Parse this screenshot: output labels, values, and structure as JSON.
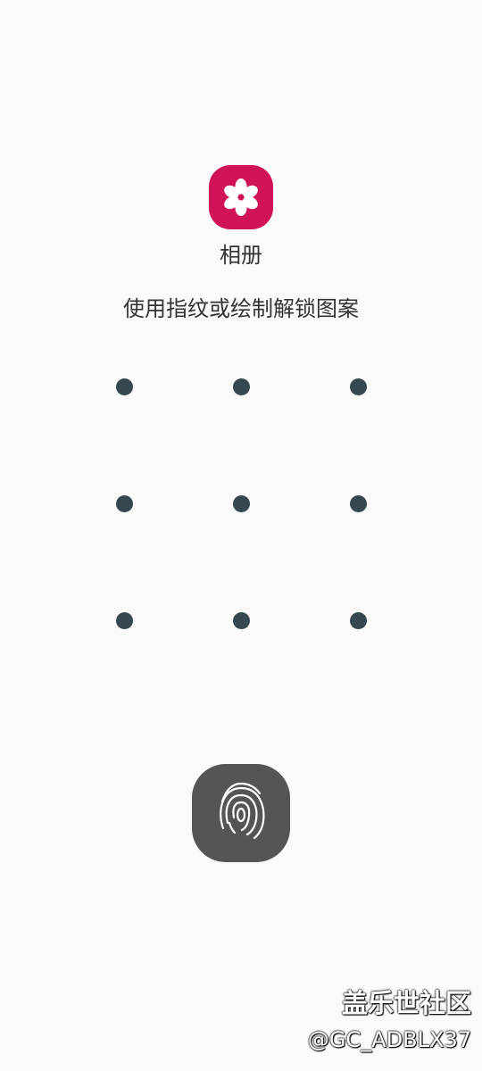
{
  "app": {
    "name": "相册",
    "icon": "gallery-flower-icon",
    "icon_color": "#d01358"
  },
  "lock": {
    "prompt": "使用指纹或绘制解锁图案",
    "pattern_dot_color": "#37474f",
    "pattern_dot_count": 9,
    "fingerprint_icon": "fingerprint-icon",
    "fingerprint_button_color": "#555555"
  },
  "watermark": {
    "title": "盖乐世社区",
    "handle": "@GC_ADBLX37"
  }
}
